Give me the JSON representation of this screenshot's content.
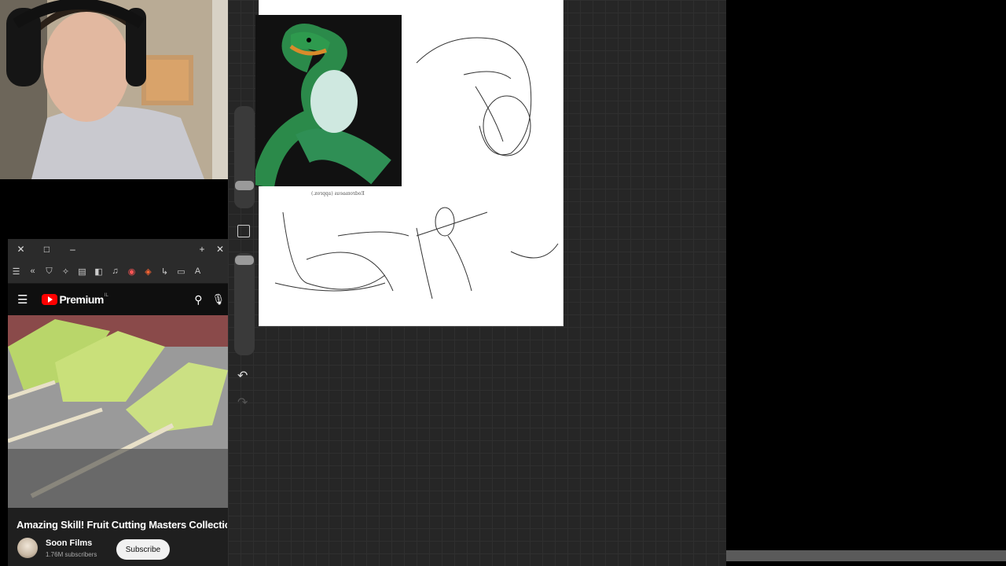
{
  "browser": {
    "titlebar": {
      "close_label": "✕",
      "restore_label": "□",
      "minimize_label": "–",
      "new_tab_label": "+",
      "tab_close_label": "✕"
    },
    "toolbar_icons": [
      "menu-icon",
      "back-double-icon",
      "shield-icon",
      "extensions-icon",
      "reading-list-icon",
      "sidebar-icon",
      "music-icon",
      "brave-rewards-icon",
      "brave-shields-icon",
      "share-icon",
      "cast-icon",
      "translate-icon"
    ]
  },
  "youtube": {
    "brand": "Premium",
    "region": "IL",
    "video_title": "Amazing Skill! Fruit Cutting Masters Collection",
    "channel_name": "Soon Films",
    "channel_subscribers": "1.76M subscribers",
    "subscribe_label": "Subscribe"
  },
  "drawing_app": {
    "reference_caption": "Eodromaeus (approx.)",
    "colors": {
      "canvas_bg": "#262626",
      "paper": "#ffffff"
    }
  }
}
